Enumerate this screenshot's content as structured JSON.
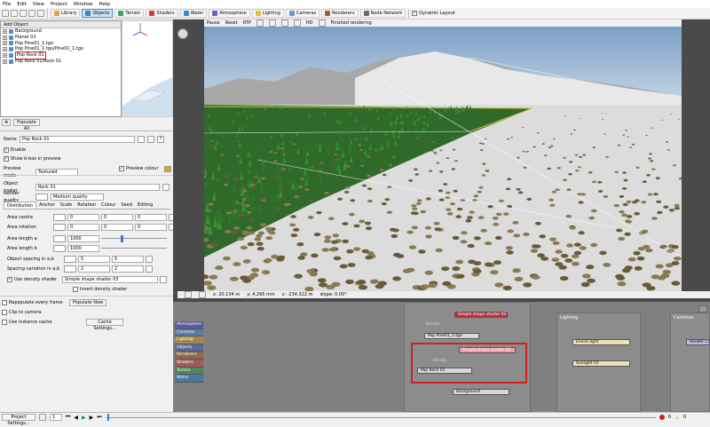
{
  "menu": [
    "File",
    "Edit",
    "View",
    "Project",
    "Window",
    "Help"
  ],
  "toolbar": {
    "tabs": [
      {
        "label": "Library",
        "color": "#e8a24a",
        "active": false
      },
      {
        "label": "Objects",
        "color": "#4a7bc6",
        "active": true
      },
      {
        "label": "Terrain",
        "color": "#3aa55a",
        "active": false
      },
      {
        "label": "Shaders",
        "color": "#d43a3a",
        "active": false
      },
      {
        "label": "Water",
        "color": "#3a8ad0",
        "active": false
      },
      {
        "label": "Atmosphere",
        "color": "#7a5ac6",
        "active": false
      },
      {
        "label": "Lighting",
        "color": "#e0c040",
        "active": false
      },
      {
        "label": "Cameras",
        "color": "#6a9ad6",
        "active": false
      },
      {
        "label": "Renderers",
        "color": "#8a6a3a",
        "active": false
      },
      {
        "label": "Node Network",
        "color": "#6a6a6a",
        "active": false
      }
    ],
    "dynamic_layout": "Dynamic Layout"
  },
  "objects": {
    "header": "Add Object",
    "items": [
      {
        "label": "Background",
        "selected": false
      },
      {
        "label": "Planet 01",
        "selected": false
      },
      {
        "label": "Pop Pine01_1.tgo",
        "selected": false
      },
      {
        "label": "Pop Pine01_1.tgo/Pine01_1.tgo",
        "selected": false
      },
      {
        "label": "Pop Rock 01",
        "selected": true
      },
      {
        "label": "Pop Rock 01/Rock 01",
        "selected": false
      }
    ],
    "populate_all": "Populate All"
  },
  "props": {
    "name_label": "Name",
    "name_value": "Pop Rock 01",
    "enable": "Enable",
    "show_bbox": "Show b-box in preview",
    "preview_mode_label": "Preview mode",
    "preview_mode_value": "Textured",
    "preview_colour": "Preview colour",
    "object_maker_label": "Object maker",
    "object_maker_value": "Rock 01",
    "render_quality_label": "Render quality",
    "render_quality_value": "Medium quality",
    "tabs": [
      "Distribution",
      "Anchor",
      "Scale",
      "Rotation",
      "Colour",
      "Seed",
      "Editing"
    ],
    "area_centre": "Area centre",
    "area_rotation": "Area rotation",
    "area_length_a": "Area length a",
    "area_length_a_value": "1000",
    "area_length_b": "Area length b",
    "area_length_b_value": "1000",
    "object_spacing": "Object spacing in a,b",
    "spacing_variation": "Spacing variation in a,b",
    "use_density_shader": "Use density shader",
    "density_shader_value": "Simple shape shader 03",
    "invert_density": "Invert density shader",
    "repopulate": "Repopulate every frame",
    "populate_now": "Populate Now",
    "clip_to_camera": "Clip to camera",
    "use_instance_cache": "Use instance cache",
    "cache_settings": "Cache Settings...",
    "zero": "0",
    "spacing_a": "5",
    "spacing_b": "5",
    "var_a": "2",
    "var_b": "2"
  },
  "viewport": {
    "toolbar": [
      "Pause",
      "Reset",
      "RTP"
    ],
    "hd": "HD",
    "status": "Finished rendering",
    "coords": {
      "x": "x: 20.134 m",
      "y": "y: 4.295 mm",
      "z": "z: -234.322 m",
      "slope": "slope: 0.00°"
    }
  },
  "nodegraph": {
    "tabs": [
      {
        "label": "Atmosphere",
        "color": "#5a5aa0"
      },
      {
        "label": "Cameras",
        "color": "#5a7aa0"
      },
      {
        "label": "Lighting",
        "color": "#a08a4a"
      },
      {
        "label": "Objects",
        "color": "#5a6aa0"
      },
      {
        "label": "Renderers",
        "color": "#8a6a4a"
      },
      {
        "label": "Shaders",
        "color": "#a05a5a"
      },
      {
        "label": "Terrain",
        "color": "#4a8a5a"
      },
      {
        "label": "Water",
        "color": "#4a7a9a"
      }
    ],
    "nodes": {
      "shader02": "Simple shape shader 02",
      "density1": "Density",
      "pine": "Pop Pine01_1.tgo",
      "shader03": "Simple shape shader 03",
      "density2": "Density",
      "rock": "Pop Rock 01",
      "background": "Background"
    },
    "lighting_col": "Lighting",
    "enviro": "Enviro light",
    "sunlight": "Sunlight 01",
    "cameras_col": "Cameras",
    "render_cam": "Render Ca"
  },
  "bottom": {
    "project_settings": "Project Settings...",
    "frame": "1",
    "counts": "0",
    "warnings": "0"
  }
}
